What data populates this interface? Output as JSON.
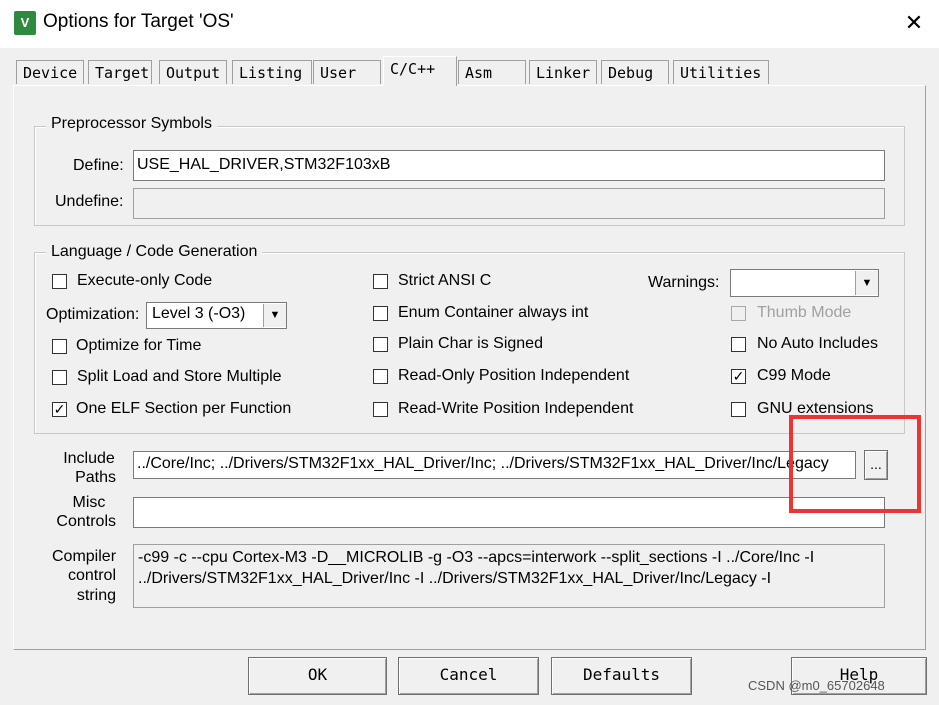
{
  "window": {
    "title": "Options for Target 'OS'",
    "close_glyph": "✕",
    "icon_label": "V"
  },
  "tabs": [
    "Device",
    "Target",
    "Output",
    "Listing",
    "User",
    "C/C++",
    "Asm",
    "Linker",
    "Debug",
    "Utilities"
  ],
  "active_tab": "C/C++",
  "preprocessor": {
    "group_label": "Preprocessor Symbols",
    "define_label": "Define:",
    "define_value": "USE_HAL_DRIVER,STM32F103xB",
    "undefine_label": "Undefine:",
    "undefine_value": ""
  },
  "language": {
    "group_label": "Language / Code Generation",
    "execute_only": {
      "label": "Execute-only Code",
      "checked": false
    },
    "optimization_label": "Optimization:",
    "optimization_value": "Level 3 (-O3)",
    "optimize_for_time": {
      "label": "Optimize for Time",
      "checked": false
    },
    "split_load_store": {
      "label": "Split Load and Store Multiple",
      "checked": false
    },
    "one_elf_section": {
      "label": "One ELF Section per Function",
      "checked": true
    },
    "strict_ansi": {
      "label": "Strict ANSI C",
      "checked": false
    },
    "enum_container": {
      "label": "Enum Container always int",
      "checked": false
    },
    "plain_char_signed": {
      "label": "Plain Char is Signed",
      "checked": false
    },
    "ro_pi": {
      "label": "Read-Only Position Independent",
      "checked": false
    },
    "rw_pi": {
      "label": "Read-Write Position Independent",
      "checked": false
    },
    "warnings_label": "Warnings:",
    "warnings_value": "",
    "thumb_mode": {
      "label": "Thumb Mode",
      "checked": false,
      "disabled": true
    },
    "no_auto_includes": {
      "label": "No Auto Includes",
      "checked": false
    },
    "c99_mode": {
      "label": "C99 Mode",
      "checked": true
    },
    "gnu_extensions": {
      "label": "GNU extensions",
      "checked": false
    }
  },
  "include_paths": {
    "label_line1": "Include",
    "label_line2": "Paths",
    "value": "../Core/Inc; ../Drivers/STM32F1xx_HAL_Driver/Inc; ../Drivers/STM32F1xx_HAL_Driver/Inc/Legacy",
    "browse_label": "..."
  },
  "misc_controls": {
    "label_line1": "Misc",
    "label_line2": "Controls",
    "value": ""
  },
  "compiler_string": {
    "label_line1": "Compiler",
    "label_line2": "control",
    "label_line3": "string",
    "line1": "-c99 -c --cpu Cortex-M3 -D__MICROLIB -g -O3 --apcs=interwork --split_sections -I ../Core/Inc -I",
    "line2": "../Drivers/STM32F1xx_HAL_Driver/Inc -I ../Drivers/STM32F1xx_HAL_Driver/Inc/Legacy -I"
  },
  "buttons": {
    "ok": "OK",
    "cancel": "Cancel",
    "defaults": "Defaults",
    "help": "Help"
  },
  "watermark": "CSDN @m0_65702648",
  "colors": {
    "highlight": "#ee3333",
    "dialog_bg": "#f0f0f0",
    "icon_green": "#2e8b3e"
  },
  "icons": {
    "check": "✓",
    "dropdown": "▼"
  }
}
